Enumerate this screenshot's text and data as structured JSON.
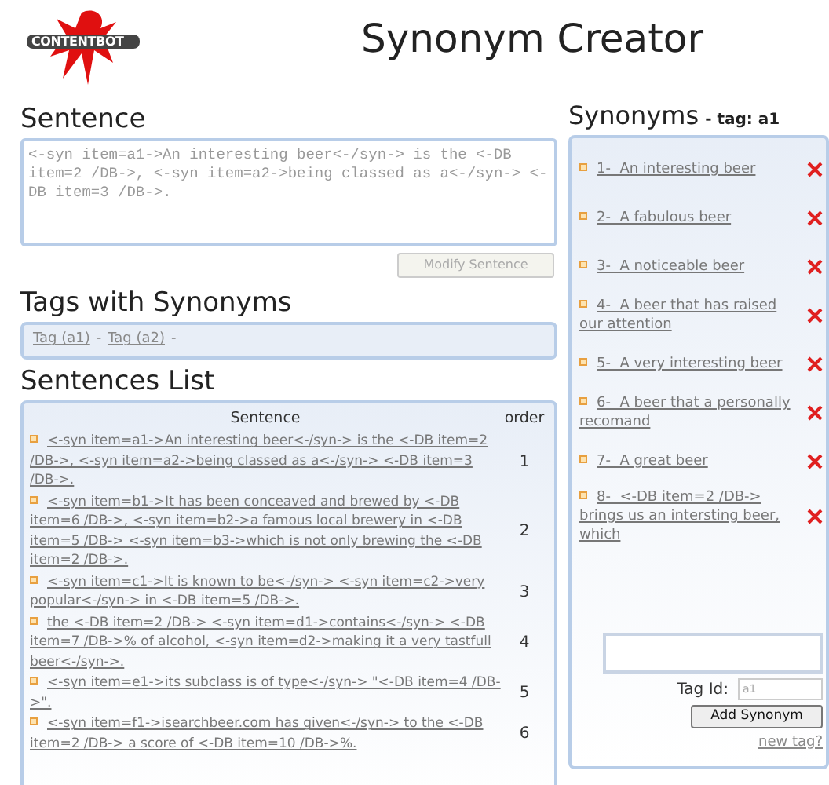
{
  "logo": {
    "text": "CONTENTBOT"
  },
  "title": "Synonym Creator",
  "sentence": {
    "heading": "Sentence",
    "value": "<-syn item=a1->An interesting beer<-/syn-> is the <-DB item=2 /DB->, <-syn item=a2->being classed as a<-/syn-> <-DB item=3 /DB->.",
    "button": {
      "label": "Modify Sentence",
      "disabled": true
    }
  },
  "tags": {
    "heading": "Tags with Synonyms",
    "items": [
      "Tag (a1)",
      "Tag (a2)"
    ],
    "separator": "-"
  },
  "sentences_list": {
    "heading": "Sentences List",
    "columns": [
      "Sentence",
      "order"
    ],
    "rows": [
      {
        "sentence": "<-syn item=a1->An interesting beer<-/syn-> is the <-DB item=2 /DB->, <-syn item=a2->being classed as a<-/syn-> <-DB item=3 /DB->.",
        "order": "1"
      },
      {
        "sentence": "<-syn item=b1->It has been conceaved and brewed by <-DB item=6 /DB->, <-syn item=b2->a famous local brewery in <-DB item=5 /DB-> <-syn item=b3->which is not only brewing the <-DB item=2 /DB->.",
        "order": "2"
      },
      {
        "sentence": "<-syn item=c1->It is known to be<-/syn-> <-syn item=c2->very popular<-/syn-> in <-DB item=5 /DB->.",
        "order": "3"
      },
      {
        "sentence": "the <-DB item=2 /DB-> <-syn item=d1->contains<-/syn-> <-DB item=7 /DB->% of alcohol, <-syn item=d2->making it a very tastfull beer<-/syn->.",
        "order": "4"
      },
      {
        "sentence": "<-syn item=e1->its subclass is of type<-/syn-> \"<-DB item=4 /DB->\".",
        "order": "5"
      },
      {
        "sentence": "<-syn item=f1->isearchbeer.com has given<-/syn-> to the <-DB item=2 /DB-> a score of <-DB item=10 /DB->%.",
        "order": "6"
      }
    ]
  },
  "synonyms": {
    "heading": "Synonyms",
    "tag_label": "- tag: a1",
    "items": [
      {
        "number": "1-",
        "text": "An interesting beer"
      },
      {
        "number": "2-",
        "text": "A fabulous beer"
      },
      {
        "number": "3-",
        "text": "A noticeable beer"
      },
      {
        "number": "4-",
        "text": "A beer that has raised our attention"
      },
      {
        "number": "5-",
        "text": "A very interesting beer"
      },
      {
        "number": "6-",
        "text": "A beer that a personally recomand"
      },
      {
        "number": "7-",
        "text": "A great beer"
      },
      {
        "number": "8-",
        "text": "<-DB item=2 /DB-> brings us an intersting beer, which"
      }
    ],
    "tag_id_label": "Tag Id:",
    "tag_id_value": "a1",
    "add_button": "Add Synonym",
    "new_tag_link": "new tag?"
  }
}
